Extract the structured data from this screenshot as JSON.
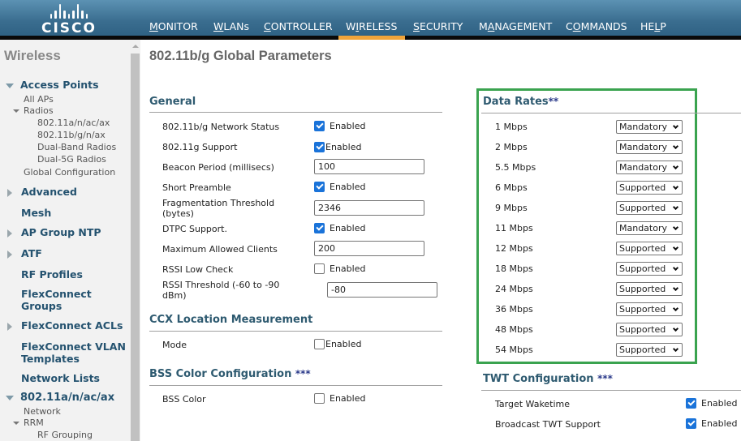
{
  "header": {
    "logo_text": "CISCO",
    "nav": [
      {
        "label": "MONITOR",
        "underline": "M",
        "rest": "ONITOR",
        "pre": ""
      },
      {
        "label": "WLANs",
        "underline": "W",
        "rest": "LANs",
        "pre": ""
      },
      {
        "label": "CONTROLLER",
        "underline": "C",
        "rest": "ONTROLLER",
        "pre": ""
      },
      {
        "label": "WIRELESS",
        "pre": "W",
        "underline": "I",
        "rest": "RELESS",
        "active": true
      },
      {
        "label": "SECURITY",
        "underline": "S",
        "rest": "ECURITY",
        "pre": ""
      },
      {
        "label": "MANAGEMENT",
        "pre": "M",
        "underline": "A",
        "rest": "NAGEMENT"
      },
      {
        "label": "COMMANDS",
        "pre": "C",
        "underline": "O",
        "rest": "MMANDS"
      },
      {
        "label": "HELP",
        "pre": "HE",
        "underline": "L",
        "rest": "P"
      }
    ],
    "active_color": "#f0a43a"
  },
  "sidebar": {
    "title": "Wireless",
    "access_points": "Access Points",
    "all_aps": "All APs",
    "radios": "Radios",
    "radio_items": [
      "802.11a/n/ac/ax",
      "802.11b/g/n/ax",
      "Dual-Band Radios",
      "Dual-5G Radios"
    ],
    "global_config": "Global Configuration",
    "advanced": "Advanced",
    "mesh": "Mesh",
    "ap_group_ntp": "AP Group NTP",
    "atf": "ATF",
    "rf_profiles": "RF Profiles",
    "flexconnect_groups_1": "FlexConnect",
    "flexconnect_groups_2": "Groups",
    "flexconnect_acls": "FlexConnect ACLs",
    "flexconnect_vlan_1": "FlexConnect VLAN",
    "flexconnect_vlan_2": "Templates",
    "network_lists": "Network Lists",
    "band_a": "802.11a/n/ac/ax",
    "network": "Network",
    "rrm": "RRM",
    "rf_grouping": "RF Grouping"
  },
  "page": {
    "title": "802.11b/g Global Parameters",
    "general": {
      "title": "General",
      "network_status_label": "802.11b/g Network Status",
      "network_status_value": "Enabled",
      "network_status_checked": true,
      "g_support_label": "802.11g Support",
      "g_support_value": "Enabled",
      "g_support_checked": true,
      "beacon_label": "Beacon Period (millisecs)",
      "beacon_value": "100",
      "short_preamble_label": "Short Preamble",
      "short_preamble_value": "Enabled",
      "short_preamble_checked": true,
      "frag_label_1": "Fragmentation Threshold",
      "frag_label_2": "(bytes)",
      "frag_value": "2346",
      "dtpc_label": "DTPC Support.",
      "dtpc_value": "Enabled",
      "dtpc_checked": true,
      "max_clients_label": "Maximum Allowed Clients",
      "max_clients_value": "200",
      "rssi_low_label": "RSSI Low Check",
      "rssi_low_value": "Enabled",
      "rssi_low_checked": false,
      "rssi_thr_label_1": "RSSI Threshold (-60 to -90",
      "rssi_thr_label_2": "dBm)",
      "rssi_thr_value": "-80"
    },
    "ccx": {
      "title": "CCX Location Measurement",
      "mode_label": "Mode",
      "mode_value": "Enabled",
      "mode_checked": false
    },
    "bss": {
      "title": "BSS Color Configuration",
      "stars": "***",
      "color_label": "BSS Color",
      "color_value": "Enabled",
      "color_checked": false
    },
    "data_rates": {
      "title": "Data Rates",
      "stars": "**",
      "highlight_color": "#3aa34f",
      "rates": [
        {
          "rate": "1 Mbps",
          "value": "Mandatory"
        },
        {
          "rate": "2 Mbps",
          "value": "Mandatory"
        },
        {
          "rate": "5.5 Mbps",
          "value": "Mandatory"
        },
        {
          "rate": "6 Mbps",
          "value": "Supported"
        },
        {
          "rate": "9 Mbps",
          "value": "Supported"
        },
        {
          "rate": "11 Mbps",
          "value": "Mandatory"
        },
        {
          "rate": "12 Mbps",
          "value": "Supported"
        },
        {
          "rate": "18 Mbps",
          "value": "Supported"
        },
        {
          "rate": "24 Mbps",
          "value": "Supported"
        },
        {
          "rate": "36 Mbps",
          "value": "Supported"
        },
        {
          "rate": "48 Mbps",
          "value": "Supported"
        },
        {
          "rate": "54 Mbps",
          "value": "Supported"
        }
      ]
    },
    "twt": {
      "title": "TWT Configuration",
      "stars": "***",
      "target_label": "Target Waketime",
      "target_value": "Enabled",
      "target_checked": true,
      "broadcast_label": "Broadcast TWT Support",
      "broadcast_value": "Enabled",
      "broadcast_checked": true
    }
  }
}
